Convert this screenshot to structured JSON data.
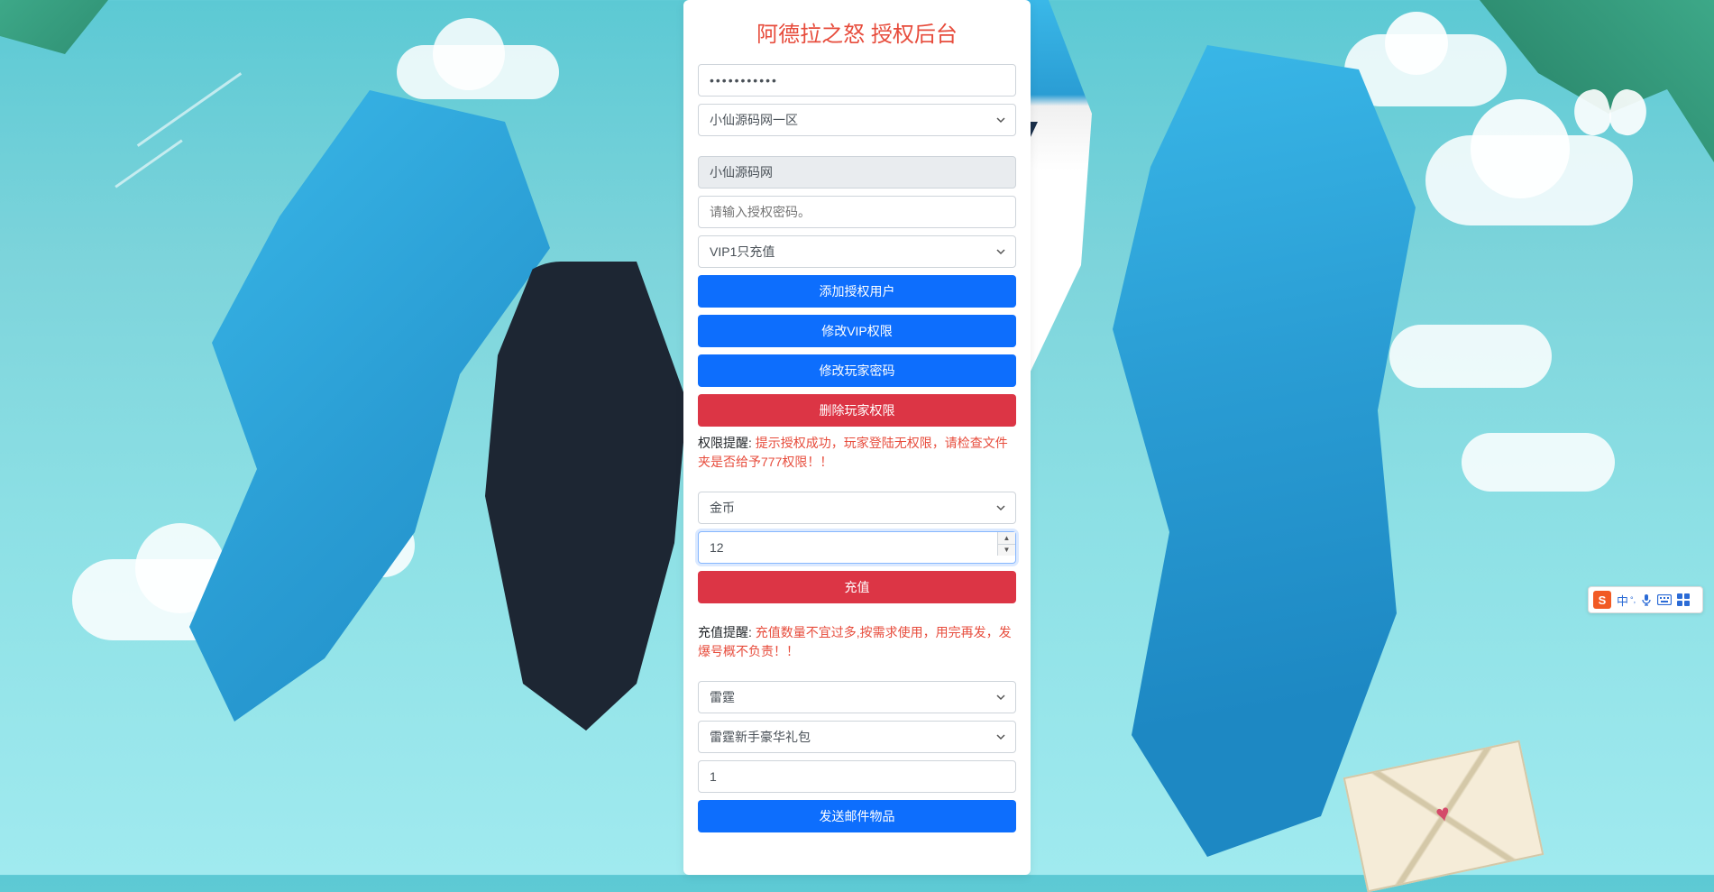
{
  "title": "阿德拉之怒 授权后台",
  "auth": {
    "password_value": "•••••••••••",
    "zone_selected": "小仙源码网一区"
  },
  "user": {
    "username_value": "小仙源码网",
    "auth_password_placeholder": "请输入授权密码。",
    "vip_selected": "VIP1只充值",
    "btn_add": "添加授权用户",
    "btn_modify_vip": "修改VIP权限",
    "btn_modify_pw": "修改玩家密码",
    "btn_delete": "删除玩家权限",
    "note_label": "权限提醒: ",
    "note_text": "提示授权成功，玩家登陆无权限，请检查文件夹是否给予777权限！！"
  },
  "recharge": {
    "currency_selected": "金币",
    "amount_value": "12",
    "btn_recharge": "充值",
    "note_label": "充值提醒: ",
    "note_text": "充值数量不宜过多,按需求使用，用完再发，发爆号概不负责！！"
  },
  "mail": {
    "category_selected": "雷霆",
    "item_selected": "雷霆新手豪华礼包",
    "qty_value": "1",
    "btn_send": "发送邮件物品"
  },
  "ime": {
    "logo": "S",
    "lang": "中"
  }
}
